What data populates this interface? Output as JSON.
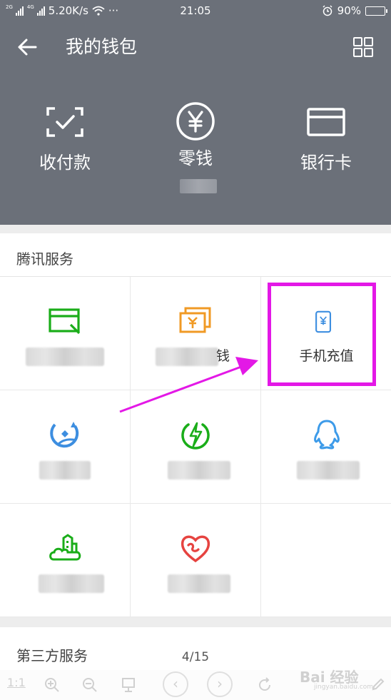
{
  "status_bar": {
    "net_tag_1": "2G",
    "net_tag_2": "4G",
    "speed": "5.20K/s",
    "more": "···",
    "time": "21:05",
    "battery": "90%",
    "battery_level": 0.9
  },
  "header": {
    "title": "我的钱包",
    "back_icon": "arrow-left-icon",
    "grid_icon": "grid-icon",
    "quick_actions": [
      {
        "label": "收付款",
        "icon": "scan-pay-icon"
      },
      {
        "label": "零钱",
        "icon": "yuan-circle-icon"
      },
      {
        "label": "银行卡",
        "icon": "bank-card-icon"
      }
    ]
  },
  "tencent_services": {
    "heading": "腾讯服务",
    "items": [
      {
        "label": "",
        "icon": "credit-card-green-icon",
        "color": "#1aad19"
      },
      {
        "label": "钱",
        "icon": "wealth-orange-icon",
        "color": "#f09a25"
      },
      {
        "label": "手机充值",
        "icon": "mobile-recharge-icon",
        "color": "#3d8ee0"
      },
      {
        "label": "",
        "icon": "finance-blue-icon",
        "color": "#3d8ee0"
      },
      {
        "label": "",
        "icon": "bolt-green-icon",
        "color": "#1aad19"
      },
      {
        "label": "",
        "icon": "qq-icon",
        "color": "#3d9be9"
      },
      {
        "label": "",
        "icon": "city-cloud-icon",
        "color": "#1aad19"
      },
      {
        "label": "",
        "icon": "heart-charity-icon",
        "color": "#e64340"
      },
      {
        "label": "",
        "icon": "",
        "color": ""
      }
    ]
  },
  "third_party": {
    "heading": "第三方服务"
  },
  "viewer": {
    "page_counter": "4/15",
    "zoom_label": "1:1",
    "watermark": "Bai 经验",
    "watermark_sub": "jingyan.baidu.com"
  },
  "colors": {
    "header_bg": "#6b7079",
    "highlight": "#e318e6"
  }
}
